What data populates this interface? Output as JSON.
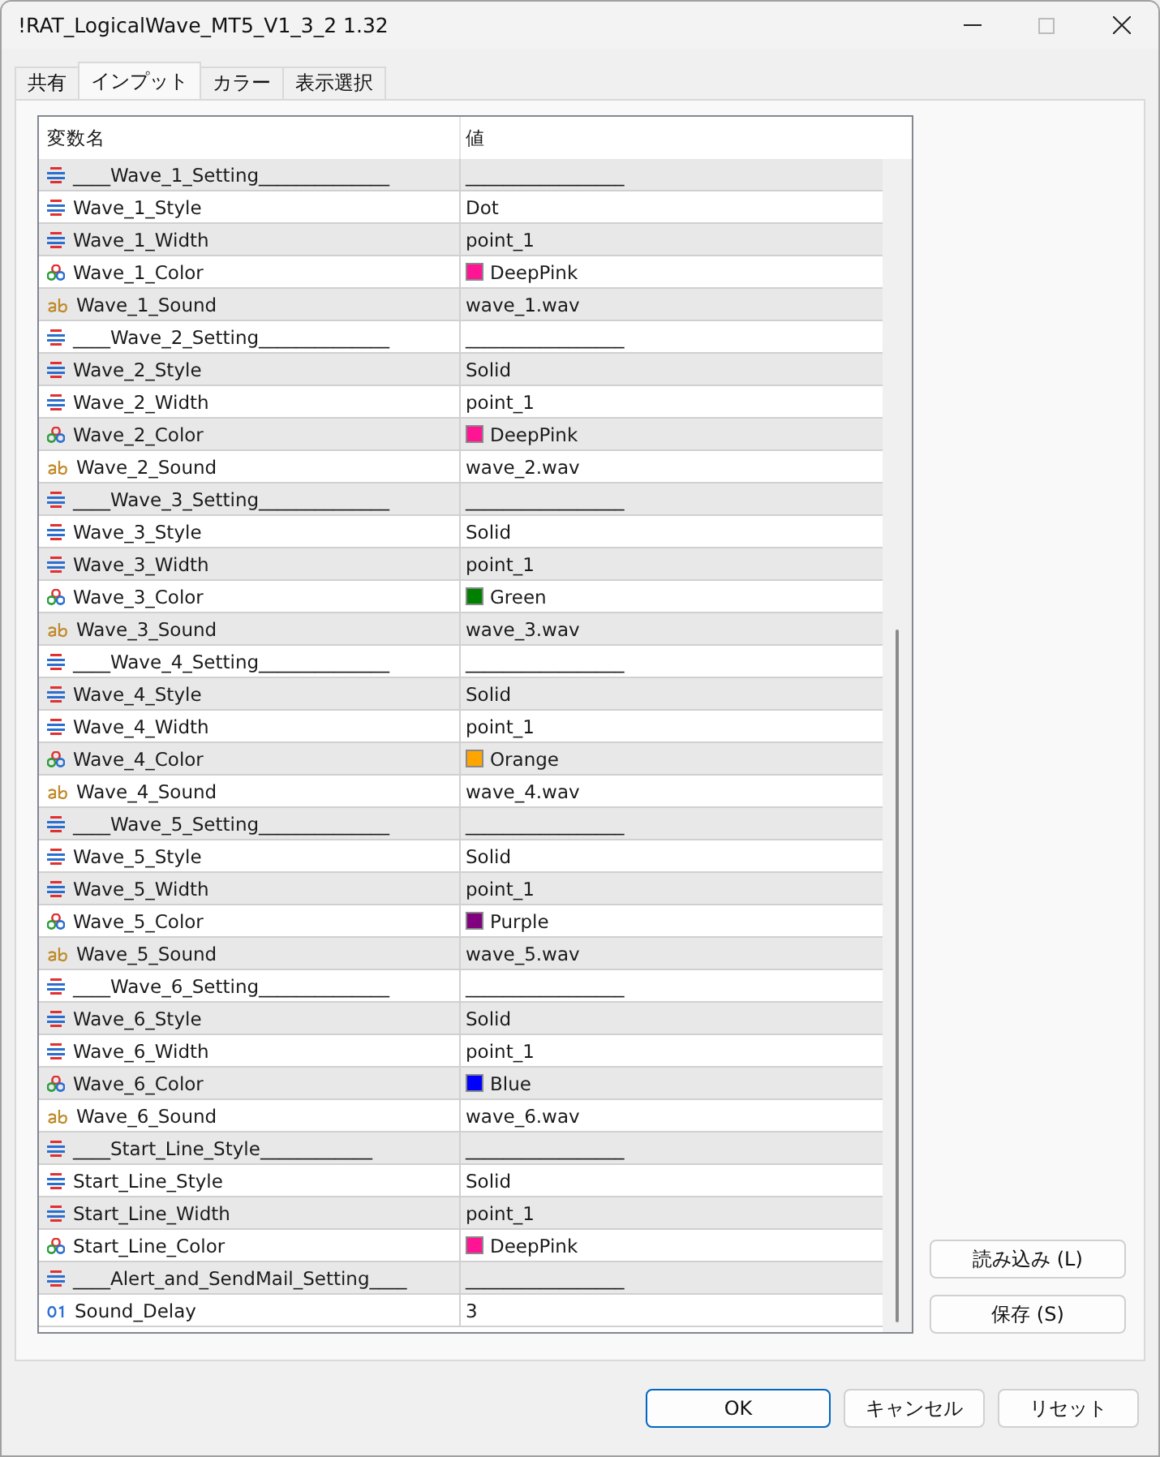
{
  "window": {
    "title": "!RAT_LogicalWave_MT5_V1_3_2 1.32"
  },
  "tabs": [
    {
      "label": "共有",
      "selected": false
    },
    {
      "label": "インプット",
      "selected": true
    },
    {
      "label": "カラー",
      "selected": false
    },
    {
      "label": "表示選択",
      "selected": false
    }
  ],
  "table": {
    "columns": [
      "変数名",
      "値"
    ],
    "rows": [
      {
        "kind": "enum",
        "name": "____Wave_1_Setting______________",
        "value": "_________________"
      },
      {
        "kind": "enum",
        "name": "Wave_1_Style",
        "value": "Dot"
      },
      {
        "kind": "enum",
        "name": "Wave_1_Width",
        "value": "point_1"
      },
      {
        "kind": "color",
        "name": "Wave_1_Color",
        "value": "DeepPink",
        "color": "#ff1493"
      },
      {
        "kind": "string",
        "name": "Wave_1_Sound",
        "value": "wave_1.wav"
      },
      {
        "kind": "enum",
        "name": "____Wave_2_Setting______________",
        "value": "_________________"
      },
      {
        "kind": "enum",
        "name": "Wave_2_Style",
        "value": "Solid"
      },
      {
        "kind": "enum",
        "name": "Wave_2_Width",
        "value": "point_1"
      },
      {
        "kind": "color",
        "name": "Wave_2_Color",
        "value": "DeepPink",
        "color": "#ff1493"
      },
      {
        "kind": "string",
        "name": "Wave_2_Sound",
        "value": "wave_2.wav"
      },
      {
        "kind": "enum",
        "name": "____Wave_3_Setting______________",
        "value": "_________________"
      },
      {
        "kind": "enum",
        "name": "Wave_3_Style",
        "value": "Solid"
      },
      {
        "kind": "enum",
        "name": "Wave_3_Width",
        "value": "point_1"
      },
      {
        "kind": "color",
        "name": "Wave_3_Color",
        "value": "Green",
        "color": "#008000"
      },
      {
        "kind": "string",
        "name": "Wave_3_Sound",
        "value": "wave_3.wav"
      },
      {
        "kind": "enum",
        "name": "____Wave_4_Setting______________",
        "value": "_________________"
      },
      {
        "kind": "enum",
        "name": "Wave_4_Style",
        "value": "Solid"
      },
      {
        "kind": "enum",
        "name": "Wave_4_Width",
        "value": "point_1"
      },
      {
        "kind": "color",
        "name": "Wave_4_Color",
        "value": "Orange",
        "color": "#ffa500"
      },
      {
        "kind": "string",
        "name": "Wave_4_Sound",
        "value": "wave_4.wav"
      },
      {
        "kind": "enum",
        "name": "____Wave_5_Setting______________",
        "value": "_________________"
      },
      {
        "kind": "enum",
        "name": "Wave_5_Style",
        "value": "Solid"
      },
      {
        "kind": "enum",
        "name": "Wave_5_Width",
        "value": "point_1"
      },
      {
        "kind": "color",
        "name": "Wave_5_Color",
        "value": "Purple",
        "color": "#800080"
      },
      {
        "kind": "string",
        "name": "Wave_5_Sound",
        "value": "wave_5.wav"
      },
      {
        "kind": "enum",
        "name": "____Wave_6_Setting______________",
        "value": "_________________"
      },
      {
        "kind": "enum",
        "name": "Wave_6_Style",
        "value": "Solid"
      },
      {
        "kind": "enum",
        "name": "Wave_6_Width",
        "value": "point_1"
      },
      {
        "kind": "color",
        "name": "Wave_6_Color",
        "value": "Blue",
        "color": "#0000ff"
      },
      {
        "kind": "string",
        "name": "Wave_6_Sound",
        "value": "wave_6.wav"
      },
      {
        "kind": "enum",
        "name": "____Start_Line_Style____________",
        "value": "_________________"
      },
      {
        "kind": "enum",
        "name": "Start_Line_Style",
        "value": "Solid"
      },
      {
        "kind": "enum",
        "name": "Start_Line_Width",
        "value": "point_1"
      },
      {
        "kind": "color",
        "name": "Start_Line_Color",
        "value": "DeepPink",
        "color": "#ff1493"
      },
      {
        "kind": "enum",
        "name": "____Alert_and_SendMail_Setting____",
        "value": "_________________"
      },
      {
        "kind": "int",
        "name": "Sound_Delay",
        "value": "3"
      }
    ]
  },
  "side_buttons": [
    "読み込み (L)",
    "保存 (S)"
  ],
  "buttons": [
    {
      "label": "OK",
      "default": true
    },
    {
      "label": "キャンセル",
      "default": false
    },
    {
      "label": "リセット",
      "default": false
    }
  ]
}
